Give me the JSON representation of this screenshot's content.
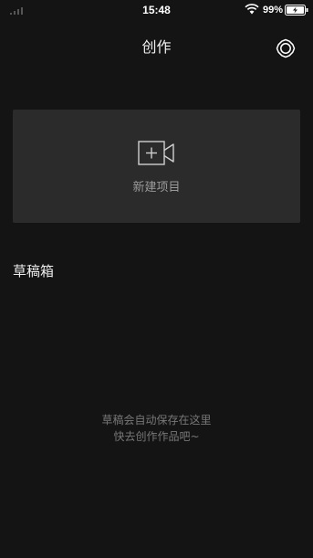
{
  "status_bar": {
    "time": "15:48",
    "battery_percent": "99%",
    "icons": [
      "signal-icon",
      "wifi-icon",
      "battery-charging-icon"
    ]
  },
  "header": {
    "title": "创作",
    "settings_icon": "gear-icon"
  },
  "new_project": {
    "label": "新建项目",
    "icon": "video-camera-add-icon"
  },
  "drafts": {
    "title": "草稿箱",
    "empty_line1": "草稿会自动保存在这里",
    "empty_line2": "快去创作作品吧~"
  },
  "colors": {
    "background": "#141414",
    "card": "#2b2b2b",
    "muted_text": "#777777",
    "card_text": "#9a9a9a"
  }
}
